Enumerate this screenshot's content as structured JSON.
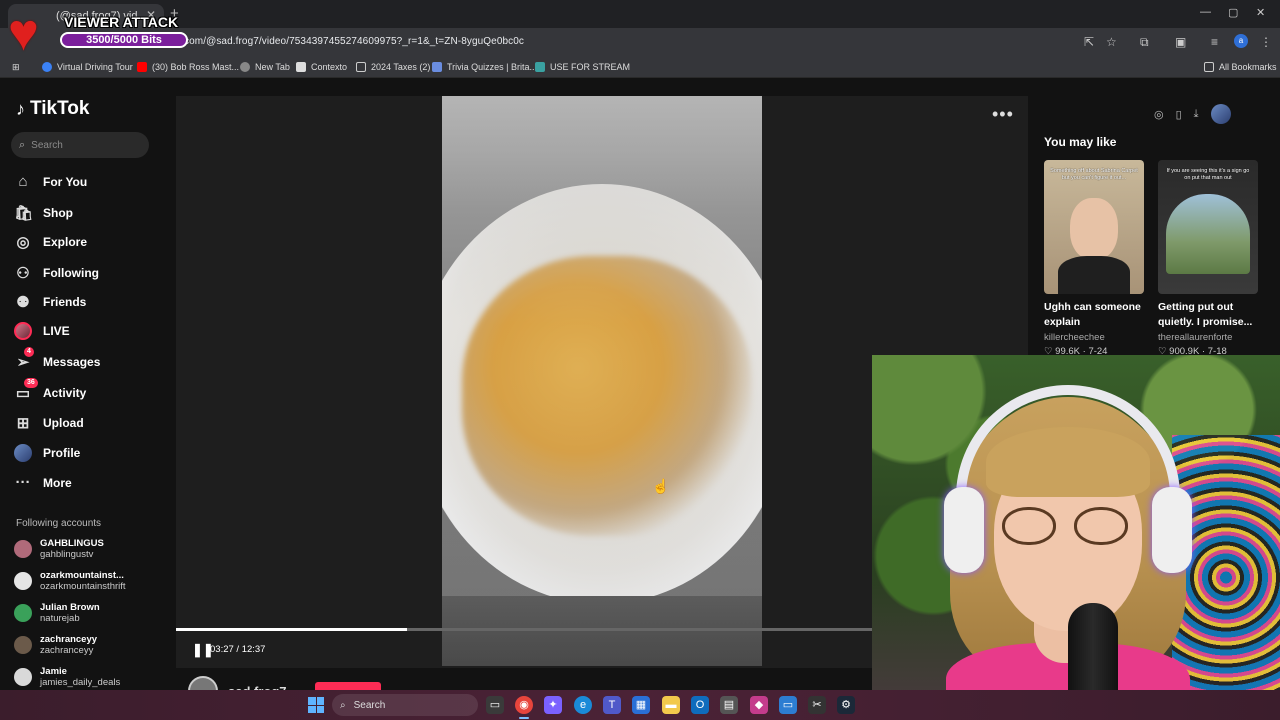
{
  "browser": {
    "tab_title": "(@sad.frog7) vid...",
    "url": "com/@sad.frog7/video/7534397455274609975?_r=1&_t=ZN-8yguQe0bc0c",
    "bookmarks": [
      "Virtual Driving Tour",
      "(30) Bob Ross Mast...",
      "New Tab",
      "Contexto",
      "2024 Taxes (2)",
      "Trivia Quizzes | Brita...",
      "USE FOR STREAM"
    ],
    "all_bookmarks": "All Bookmarks",
    "profile_initial": "a"
  },
  "overlay": {
    "title": "VIEWER ATTACK",
    "bits": "3500/5000 Bits",
    "bits_progress": 0.7
  },
  "tiktok": {
    "logo": "TikTok",
    "search_placeholder": "Search",
    "nav": [
      {
        "label": "For You",
        "icon": "home-icon"
      },
      {
        "label": "Shop",
        "icon": "shop-icon"
      },
      {
        "label": "Explore",
        "icon": "compass-icon"
      },
      {
        "label": "Following",
        "icon": "following-icon"
      },
      {
        "label": "Friends",
        "icon": "friends-icon"
      },
      {
        "label": "LIVE",
        "icon": "live-avatar-icon"
      },
      {
        "label": "Messages",
        "icon": "messages-icon",
        "badge": "4"
      },
      {
        "label": "Activity",
        "icon": "activity-icon",
        "badge": "36"
      },
      {
        "label": "Upload",
        "icon": "upload-icon"
      },
      {
        "label": "Profile",
        "icon": "profile-avatar-icon"
      },
      {
        "label": "More",
        "icon": "more-icon"
      }
    ],
    "following_title": "Following accounts",
    "following": [
      {
        "name": "GAHBLINGUS",
        "handle": "gahblingustv",
        "color": "#b06a7a"
      },
      {
        "name": "ozarkmountainst...",
        "handle": "ozarkmountainsthrift",
        "color": "#e5e5e5"
      },
      {
        "name": "Julian Brown",
        "handle": "naturejab",
        "color": "#3aa15a"
      },
      {
        "name": "zachranceyy",
        "handle": "zachranceyy",
        "color": "#6b5a4a"
      },
      {
        "name": "Jamie",
        "handle": "jamies_daily_deals",
        "color": "#d9d9d9"
      }
    ],
    "player": {
      "time": "03:27 / 12:37",
      "progress": 0.33,
      "author": "sad.frog7"
    },
    "you_may_like": "You may like",
    "cards": [
      {
        "caption": "Ughh can someone explain",
        "user": "killercheechee",
        "likes": "99.6K",
        "date": "7-24",
        "thumb_text": "Something off about Sabrina Carpet but you can't figure it out..."
      },
      {
        "caption": "Getting put out quietly. I promise...",
        "user": "thereallaurenforte",
        "likes": "900.9K",
        "date": "7-18",
        "thumb_text": "If you are seeing this it's a sign go on put that man out"
      }
    ]
  },
  "taskbar": {
    "search": "Search"
  },
  "colors": {
    "accent": "#fe2c55",
    "badge_purple": "#7b1f9c"
  }
}
